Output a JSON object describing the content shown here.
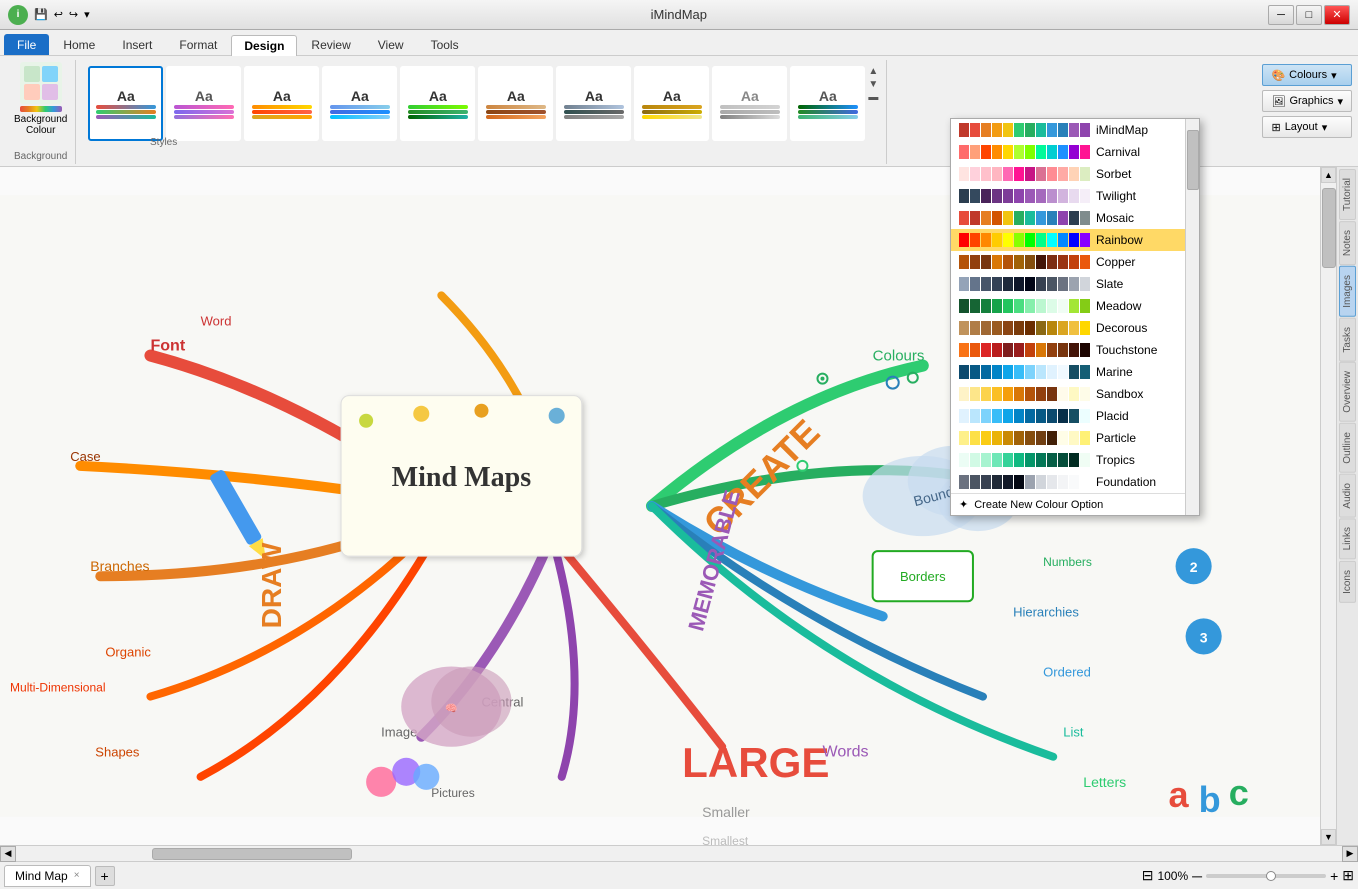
{
  "titlebar": {
    "title": "iMindMap",
    "logo_text": "i",
    "controls": {
      "minimize": "─",
      "maximize": "□",
      "close": "✕"
    }
  },
  "tabs": [
    "File",
    "Home",
    "Insert",
    "Format",
    "Design",
    "Review",
    "View",
    "Tools"
  ],
  "active_tab": "Design",
  "ribbon": {
    "background_colour": {
      "label_line1": "Background",
      "label_line2": "Colour",
      "group_label": "Background"
    },
    "styles_group_label": "Styles",
    "colours_btn": "Colours",
    "graphics_btn": "Graphics",
    "layout_btn": "Layout"
  },
  "colours_dropdown": {
    "items": [
      {
        "name": "iMindMap",
        "swatches": [
          "#c0392b",
          "#e74c3c",
          "#e67e22",
          "#f39c12",
          "#f1c40f",
          "#2ecc71",
          "#27ae60",
          "#1abc9c",
          "#3498db",
          "#2980b9",
          "#9b59b6",
          "#8e44ad"
        ]
      },
      {
        "name": "Carnival",
        "swatches": [
          "#ff6b6b",
          "#ffa07a",
          "#ff4500",
          "#ff8c00",
          "#ffd700",
          "#adff2f",
          "#7fff00",
          "#00fa9a",
          "#00ced1",
          "#1e90ff",
          "#9400d3",
          "#ff1493"
        ]
      },
      {
        "name": "Sorbet",
        "swatches": [
          "#ffe4e1",
          "#ffd1dc",
          "#ffc0cb",
          "#ffb6c1",
          "#ff69b4",
          "#ff1493",
          "#c71585",
          "#db7093",
          "#ff8c94",
          "#ffaaa5",
          "#ffd3b6",
          "#dcedc1"
        ]
      },
      {
        "name": "Twilight",
        "swatches": [
          "#2c3e50",
          "#34495e",
          "#4a235a",
          "#6c3483",
          "#7d3c98",
          "#8e44ad",
          "#9b59b6",
          "#a569bd",
          "#bb8fce",
          "#d2b4de",
          "#e8daef",
          "#f5eef8"
        ]
      },
      {
        "name": "Mosaic",
        "swatches": [
          "#e74c3c",
          "#c0392b",
          "#e67e22",
          "#d35400",
          "#f1c40f",
          "#27ae60",
          "#1abc9c",
          "#3498db",
          "#2980b9",
          "#8e44ad",
          "#2c3e50",
          "#7f8c8d"
        ]
      },
      {
        "name": "Rainbow",
        "swatches": [
          "#ff0000",
          "#ff4400",
          "#ff8800",
          "#ffcc00",
          "#ffff00",
          "#88ff00",
          "#00ff00",
          "#00ff88",
          "#00ffff",
          "#0088ff",
          "#0000ff",
          "#8800ff"
        ],
        "selected": true
      },
      {
        "name": "Copper",
        "swatches": [
          "#b45309",
          "#92400e",
          "#78350f",
          "#d97706",
          "#b45309",
          "#a16207",
          "#854d0e",
          "#431407",
          "#7c2d12",
          "#9a3412",
          "#c2410c",
          "#ea580c"
        ]
      },
      {
        "name": "Slate",
        "swatches": [
          "#94a3b8",
          "#64748b",
          "#475569",
          "#334155",
          "#1e293b",
          "#0f172a",
          "#020617",
          "#374151",
          "#4b5563",
          "#6b7280",
          "#9ca3af",
          "#d1d5db"
        ]
      },
      {
        "name": "Meadow",
        "swatches": [
          "#14532d",
          "#166534",
          "#15803d",
          "#16a34a",
          "#22c55e",
          "#4ade80",
          "#86efac",
          "#bbf7d0",
          "#dcfce7",
          "#f0fdf4",
          "#a3e635",
          "#84cc16"
        ]
      },
      {
        "name": "Decorous",
        "swatches": [
          "#c0935c",
          "#b07d47",
          "#a06833",
          "#9a5a1f",
          "#8b4513",
          "#7a3b0a",
          "#6b2e00",
          "#8b6914",
          "#b8860b",
          "#daa520",
          "#f0c040",
          "#ffd700"
        ]
      },
      {
        "name": "Touchstone",
        "swatches": [
          "#f97316",
          "#ea580c",
          "#dc2626",
          "#b91c1c",
          "#7f1d1d",
          "#991b1b",
          "#c2410c",
          "#d97706",
          "#92400e",
          "#78350f",
          "#431407",
          "#1c0400"
        ]
      },
      {
        "name": "Marine",
        "swatches": [
          "#0c4a6e",
          "#075985",
          "#0369a1",
          "#0284c7",
          "#0ea5e9",
          "#38bdf8",
          "#7dd3fc",
          "#bae6fd",
          "#e0f2fe",
          "#f0f9ff",
          "#164e63",
          "#155e75"
        ]
      },
      {
        "name": "Sandbox",
        "swatches": [
          "#fef3c7",
          "#fde68a",
          "#fcd34d",
          "#fbbf24",
          "#f59e0b",
          "#d97706",
          "#b45309",
          "#92400e",
          "#78350f",
          "#fffbeb",
          "#fef9c3",
          "#fefce8"
        ]
      },
      {
        "name": "Placid",
        "swatches": [
          "#e0f2fe",
          "#bae6fd",
          "#7dd3fc",
          "#38bdf8",
          "#0ea5e9",
          "#0284c7",
          "#0369a1",
          "#075985",
          "#0c4a6e",
          "#082f49",
          "#164e63",
          "#ecfeff"
        ]
      },
      {
        "name": "Particle",
        "swatches": [
          "#fef08a",
          "#fde047",
          "#facc15",
          "#eab308",
          "#ca8a04",
          "#a16207",
          "#854d0e",
          "#713f12",
          "#422006",
          "#fffde7",
          "#fff9c4",
          "#fff176"
        ]
      },
      {
        "name": "Tropics",
        "swatches": [
          "#ecfdf5",
          "#d1fae5",
          "#a7f3d0",
          "#6ee7b7",
          "#34d399",
          "#10b981",
          "#059669",
          "#047857",
          "#065f46",
          "#064e3b",
          "#022c22",
          "#f0fdf4"
        ]
      },
      {
        "name": "Foundation",
        "swatches": [
          "#6b7280",
          "#4b5563",
          "#374151",
          "#1f2937",
          "#111827",
          "#030712",
          "#9ca3af",
          "#d1d5db",
          "#e5e7eb",
          "#f3f4f6",
          "#f9fafb",
          "#ffffff"
        ]
      }
    ],
    "create_new_label": "Create New Colour Option",
    "scroll_up": "▲",
    "scroll_down": "▼"
  },
  "mindmap": {
    "center_text": "Mind Maps",
    "nodes": [
      "Font",
      "Word",
      "Case",
      "Branches",
      "Organic",
      "Multi-Dimensional",
      "Shapes",
      "Image",
      "Central",
      "Pictures",
      "LARGE",
      "Words",
      "Smaller",
      "Smallest",
      "Hierarchies",
      "Ordered",
      "List",
      "Letters",
      "Numbers",
      "Colours",
      "Boundaries",
      "Borders",
      "CREATE",
      "DRAW",
      "MEMORABLE"
    ]
  },
  "bottom_tab": {
    "label": "Mind Map",
    "close": "×"
  },
  "zoom": {
    "level": "100%",
    "minus": "─",
    "plus": "+"
  },
  "sidebar_tabs": [
    "Tutorial",
    "Notes",
    "Images",
    "Tasks",
    "Overview",
    "Outline",
    "Audio",
    "Links",
    "Icons"
  ]
}
